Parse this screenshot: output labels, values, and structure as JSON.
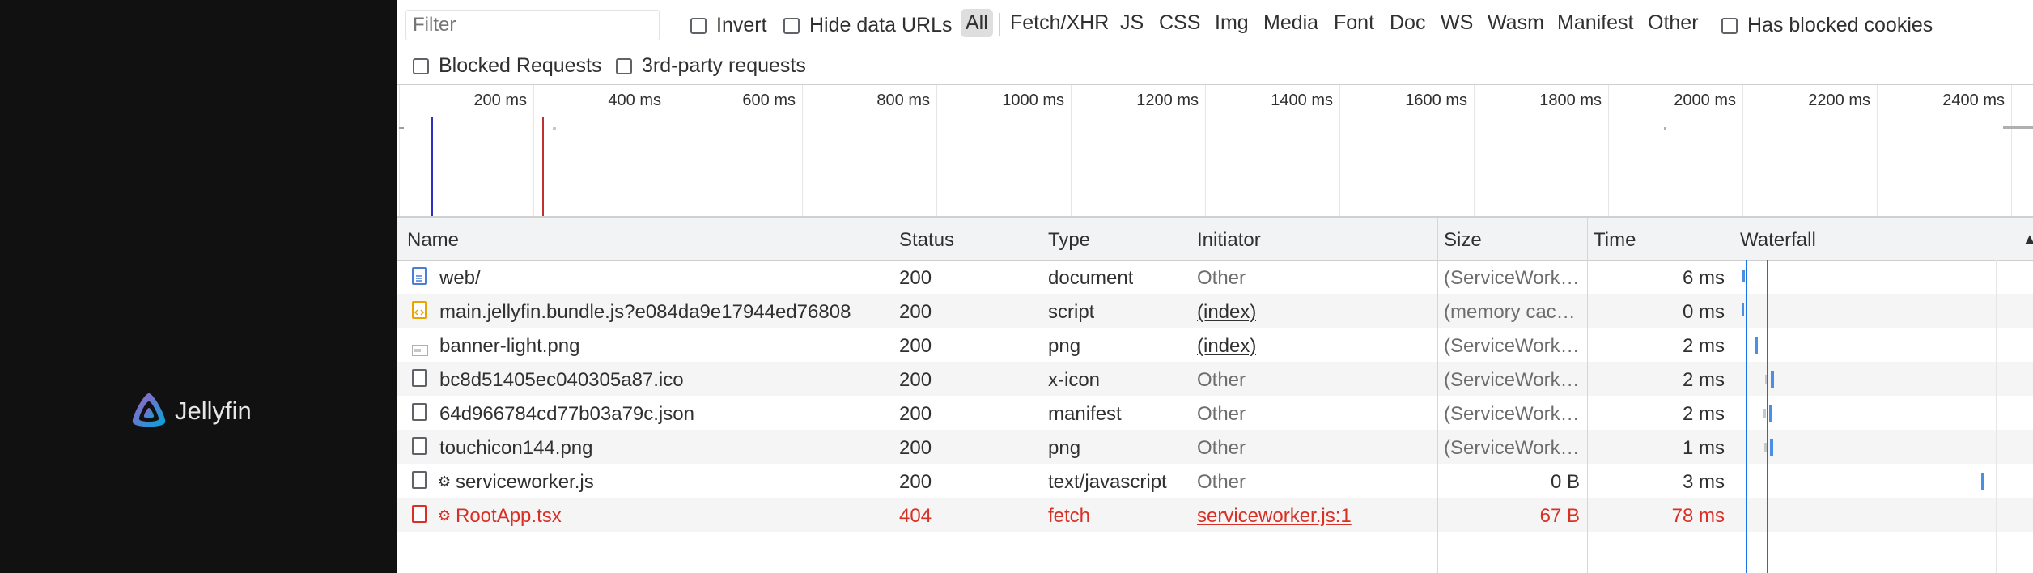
{
  "brand": {
    "name": "Jellyfin"
  },
  "toolbar": {
    "filter_placeholder": "Filter",
    "invert_label": "Invert",
    "hide_data_urls_label": "Hide data URLs",
    "types": [
      "All",
      "Fetch/XHR",
      "JS",
      "CSS",
      "Img",
      "Media",
      "Font",
      "Doc",
      "WS",
      "Wasm",
      "Manifest",
      "Other"
    ],
    "active_type": "All",
    "has_blocked_cookies_label": "Has blocked cookies",
    "blocked_requests_label": "Blocked Requests",
    "third_party_label": "3rd-party requests"
  },
  "timeline": {
    "ticks": [
      "200 ms",
      "400 ms",
      "600 ms",
      "800 ms",
      "1000 ms",
      "1200 ms",
      "1400 ms",
      "1600 ms",
      "1800 ms",
      "2000 ms",
      "2200 ms",
      "2400 ms"
    ]
  },
  "table": {
    "columns": {
      "name": "Name",
      "status": "Status",
      "type": "Type",
      "initiator": "Initiator",
      "size": "Size",
      "time": "Time",
      "waterfall": "Waterfall"
    },
    "rows": [
      {
        "name": "web/",
        "status": "200",
        "type": "document",
        "initiator": "Other",
        "size": "(ServiceWork…",
        "time": "6 ms",
        "icon": "document-icon"
      },
      {
        "name": "main.jellyfin.bundle.js?e084da9e17944ed76808",
        "status": "200",
        "type": "script",
        "initiator": "(index)",
        "size": "(memory cac…",
        "time": "0 ms",
        "icon": "script-icon"
      },
      {
        "name": "banner-light.png",
        "status": "200",
        "type": "png",
        "initiator": "(index)",
        "size": "(ServiceWork…",
        "time": "2 ms",
        "icon": "image-icon"
      },
      {
        "name": "bc8d51405ec040305a87.ico",
        "status": "200",
        "type": "x-icon",
        "initiator": "Other",
        "size": "(ServiceWork…",
        "time": "2 ms",
        "icon": "file-icon"
      },
      {
        "name": "64d966784cd77b03a79c.json",
        "status": "200",
        "type": "manifest",
        "initiator": "Other",
        "size": "(ServiceWork…",
        "time": "2 ms",
        "icon": "file-icon"
      },
      {
        "name": "touchicon144.png",
        "status": "200",
        "type": "png",
        "initiator": "Other",
        "size": "(ServiceWork…",
        "time": "1 ms",
        "icon": "file-icon"
      },
      {
        "name": "serviceworker.js",
        "status": "200",
        "type": "text/javascript",
        "initiator": "Other",
        "size": "0 B",
        "time": "3 ms",
        "icon": "file-icon",
        "gear": "⚙"
      },
      {
        "name": "RootApp.tsx",
        "status": "404",
        "type": "fetch",
        "initiator": "serviceworker.js:1",
        "size": "67 B",
        "time": "78 ms",
        "icon": "file-icon",
        "gear": "⚙",
        "error": true
      }
    ]
  },
  "colors": {
    "accent_blue": "#1a73e8",
    "error_red": "#d93025",
    "jellyfin_purple": "#aa5cc3",
    "jellyfin_blue": "#00a4dc"
  }
}
